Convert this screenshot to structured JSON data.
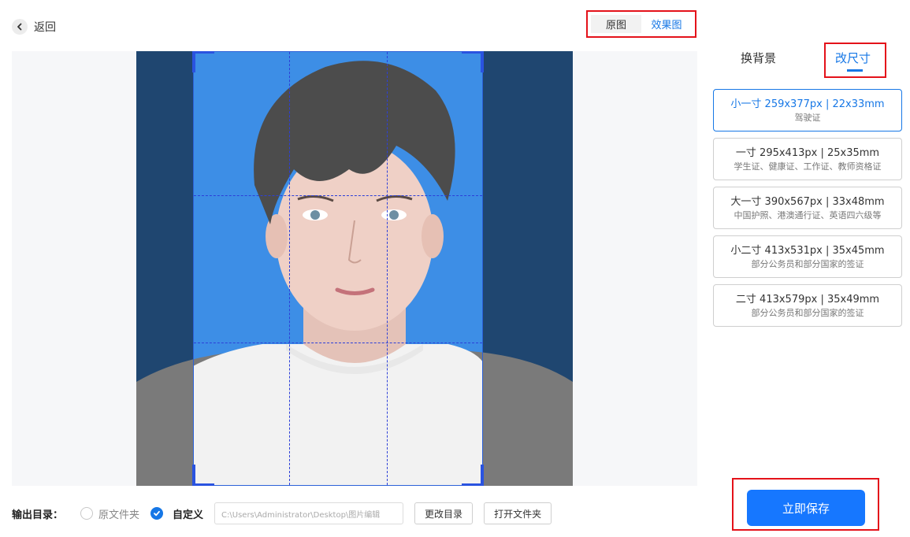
{
  "header": {
    "back_label": "返回"
  },
  "view_toggle": {
    "tabs": [
      "原图",
      "效果图"
    ],
    "active": "效果图"
  },
  "right_panel": {
    "tabs": [
      "换背景",
      "改尺寸"
    ],
    "active_tab": "改尺寸",
    "sizes": [
      {
        "title": "小一寸 259x377px | 22x33mm",
        "desc": "驾驶证",
        "active": true
      },
      {
        "title": "一寸 295x413px | 25x35mm",
        "desc": "学生证、健康证、工作证、教师资格证"
      },
      {
        "title": "大一寸 390x567px | 33x48mm",
        "desc": "中国护照、港澳通行证、英语四六级等"
      },
      {
        "title": "小二寸 413x531px | 35x45mm",
        "desc": "部分公务员和部分国家的签证"
      },
      {
        "title": "二寸 413x579px | 35x49mm",
        "desc": "部分公务员和部分国家的签证"
      }
    ],
    "save_label": "立即保存"
  },
  "output": {
    "label": "输出目录：",
    "option_original": "原文件夹",
    "option_custom": "自定义",
    "selected": "自定义",
    "path_value": "C:\\Users\\Administrator\\Desktop\\图片编辑",
    "change_dir_label": "更改目录",
    "open_folder_label": "打开文件夹"
  },
  "colors": {
    "accent": "#1677e6",
    "photo_background": "#3d8ee6",
    "outer_background": "#1f4670",
    "highlight_box": "#e4121a"
  }
}
